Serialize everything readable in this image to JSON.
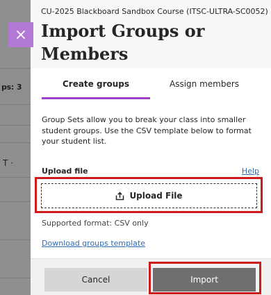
{
  "background": {
    "fragment_top": "ps: 3",
    "fragment_mid": "T ·"
  },
  "panel": {
    "course_name": "CU-2025 Blackboard Sandbox Course (ITSC-ULTRA-SC0052)",
    "title": "Import Groups or Members",
    "close_icon": "close-icon"
  },
  "tabs": [
    {
      "label": "Create groups",
      "active": true
    },
    {
      "label": "Assign members",
      "active": false
    }
  ],
  "content": {
    "description": "Group Sets allow you to break your class into smaller student groups. Use the CSV template below to format your student list.",
    "upload_label": "Upload file",
    "help_link": "Help",
    "upload_button": "Upload File",
    "upload_icon": "upload-icon",
    "supported_format": "Supported format: CSV only",
    "download_link": "Download groups template"
  },
  "footer": {
    "cancel_label": "Cancel",
    "import_label": "Import"
  },
  "colors": {
    "accent": "#9d3fc8",
    "close_button": "#b27ad6",
    "highlight": "#cc1b1b",
    "link": "#2e6bb3",
    "import_button": "#6f6f6f"
  }
}
